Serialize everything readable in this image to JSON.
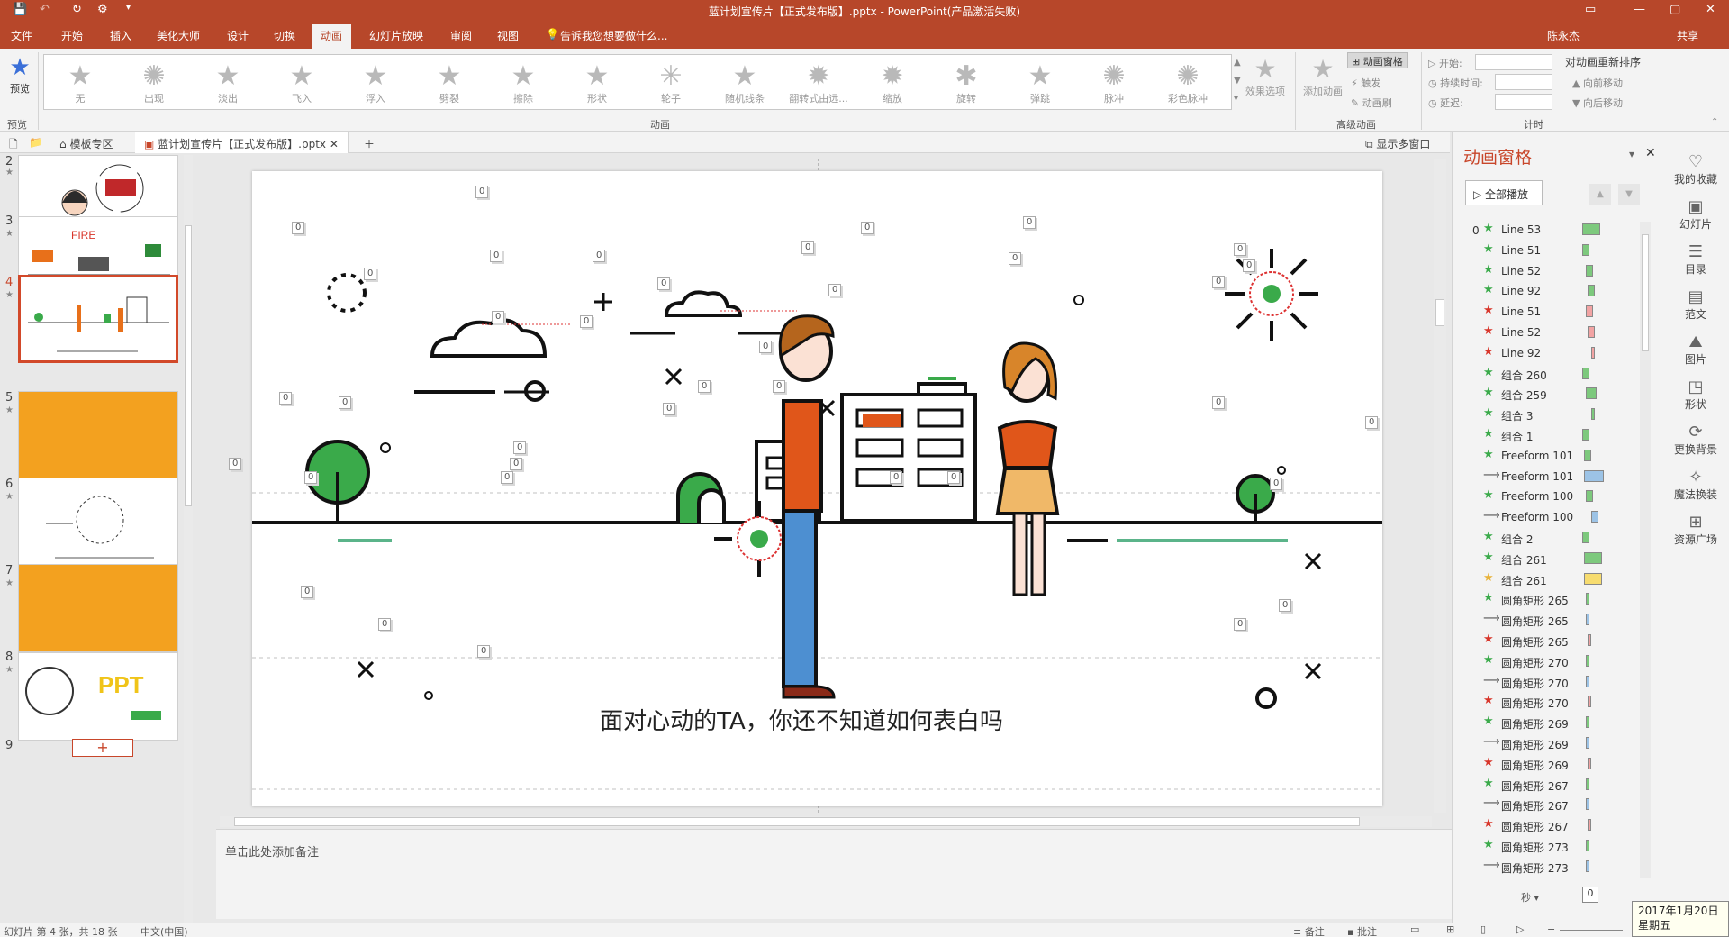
{
  "window": {
    "title": "蓝计划宣传片【正式发布版】.pptx - PowerPoint(产品激活失败)",
    "user": "陈永杰",
    "share": "共享"
  },
  "menu": {
    "tabs": [
      "文件",
      "开始",
      "插入",
      "美化大师",
      "设计",
      "切换",
      "动画",
      "幻灯片放映",
      "审阅",
      "视图"
    ],
    "active_tab": "动画",
    "tell_me": "告诉我您想要做什么..."
  },
  "ribbon": {
    "preview_label": "预览",
    "preview_group": "预览",
    "animations": [
      "无",
      "出现",
      "淡出",
      "飞入",
      "浮入",
      "劈裂",
      "擦除",
      "形状",
      "轮子",
      "随机线条",
      "翻转式由远...",
      "缩放",
      "旋转",
      "弹跳",
      "脉冲",
      "彩色脉冲"
    ],
    "animation_group": "动画",
    "effect_options": "效果选项",
    "add_animation": "添加动画",
    "anim_pane_btn": "动画窗格",
    "trigger": "触发",
    "anim_painter": "动画刷",
    "advanced_group": "高级动画",
    "start_label": "开始:",
    "duration_label": "持续时间:",
    "delay_label": "延迟:",
    "reorder_title": "对动画重新排序",
    "move_earlier": "向前移动",
    "move_later": "向后移动",
    "timing_group": "计时"
  },
  "doc_tabs": {
    "template": "模板专区",
    "file": "蓝计划宣传片【正式发布版】.pptx",
    "multi_window": "显示多窗口"
  },
  "thumbnails": {
    "numbers": [
      "2",
      "3",
      "4",
      "5",
      "6",
      "7",
      "8",
      "9"
    ],
    "selected": "4",
    "fire_text": "FIRE",
    "ppt_text": "PPT"
  },
  "slide": {
    "caption": "面对心动的TA，你还不知道如何表白吗",
    "badge_text": "0"
  },
  "notes": {
    "placeholder": "单击此处添加备注"
  },
  "anim_pane": {
    "title": "动画窗格",
    "play_all": "全部播放",
    "first_index": "0",
    "items": [
      {
        "name": "Line 53",
        "type": "entrance",
        "bar": "#7dc97d"
      },
      {
        "name": "Line 51",
        "type": "entrance",
        "bar": "#7dc97d"
      },
      {
        "name": "Line 52",
        "type": "entrance",
        "bar": "#7dc97d"
      },
      {
        "name": "Line 92",
        "type": "entrance",
        "bar": "#7dc97d"
      },
      {
        "name": "Line 51",
        "type": "exit",
        "bar": "#f2a3a3"
      },
      {
        "name": "Line 52",
        "type": "exit",
        "bar": "#f2a3a3"
      },
      {
        "name": "Line 92",
        "type": "exit",
        "bar": "#f2a3a3"
      },
      {
        "name": "组合 260",
        "type": "entrance",
        "bar": "#7dc97d"
      },
      {
        "name": "组合 259",
        "type": "entrance",
        "bar": "#7dc97d"
      },
      {
        "name": "组合 3",
        "type": "entrance",
        "bar": "#7dc97d"
      },
      {
        "name": "组合 1",
        "type": "entrance",
        "bar": "#7dc97d"
      },
      {
        "name": "Freeform 101",
        "type": "entrance",
        "bar": "#7dc97d"
      },
      {
        "name": "Freeform 101",
        "type": "path",
        "bar": "#9cc3e6"
      },
      {
        "name": "Freeform 100",
        "type": "entrance",
        "bar": "#7dc97d"
      },
      {
        "name": "Freeform 100",
        "type": "path",
        "bar": "#9cc3e6"
      },
      {
        "name": "组合 2",
        "type": "entrance",
        "bar": "#7dc97d"
      },
      {
        "name": "组合 261",
        "type": "entrance",
        "bar": "#7dc97d"
      },
      {
        "name": "组合 261",
        "type": "emphasis",
        "bar": "#f7dc6f"
      },
      {
        "name": "圆角矩形 265",
        "type": "entrance",
        "bar": "#7dc97d"
      },
      {
        "name": "圆角矩形 265",
        "type": "path",
        "bar": "#9cc3e6"
      },
      {
        "name": "圆角矩形 265",
        "type": "exit",
        "bar": "#f2a3a3"
      },
      {
        "name": "圆角矩形 270",
        "type": "entrance",
        "bar": "#7dc97d"
      },
      {
        "name": "圆角矩形 270",
        "type": "path",
        "bar": "#9cc3e6"
      },
      {
        "name": "圆角矩形 270",
        "type": "exit",
        "bar": "#f2a3a3"
      },
      {
        "name": "圆角矩形 269",
        "type": "entrance",
        "bar": "#7dc97d"
      },
      {
        "name": "圆角矩形 269",
        "type": "path",
        "bar": "#9cc3e6"
      },
      {
        "name": "圆角矩形 269",
        "type": "exit",
        "bar": "#f2a3a3"
      },
      {
        "name": "圆角矩形 267",
        "type": "entrance",
        "bar": "#7dc97d"
      },
      {
        "name": "圆角矩形 267",
        "type": "path",
        "bar": "#9cc3e6"
      },
      {
        "name": "圆角矩形 267",
        "type": "exit",
        "bar": "#f2a3a3"
      },
      {
        "name": "圆角矩形 273",
        "type": "entrance",
        "bar": "#7dc97d"
      },
      {
        "name": "圆角矩形 273",
        "type": "path",
        "bar": "#9cc3e6"
      }
    ],
    "seconds_label": "秒",
    "zoom_value": "0"
  },
  "side_strip": {
    "items": [
      "我的收藏",
      "幻灯片",
      "目录",
      "范文",
      "图片",
      "形状",
      "更换背景",
      "魔法换装",
      "资源广场"
    ]
  },
  "status": {
    "slide_info": "幻灯片 第 4 张，共 18 张",
    "language": "中文(中国)",
    "notes_btn": "备注",
    "comments_btn": "批注"
  },
  "clock": {
    "date": "2017年1月20日",
    "weekday": "星期五"
  },
  "colors": {
    "accent": "#b7472a",
    "orange_slide": "#f3a11f",
    "green": "#3aaa4a"
  }
}
